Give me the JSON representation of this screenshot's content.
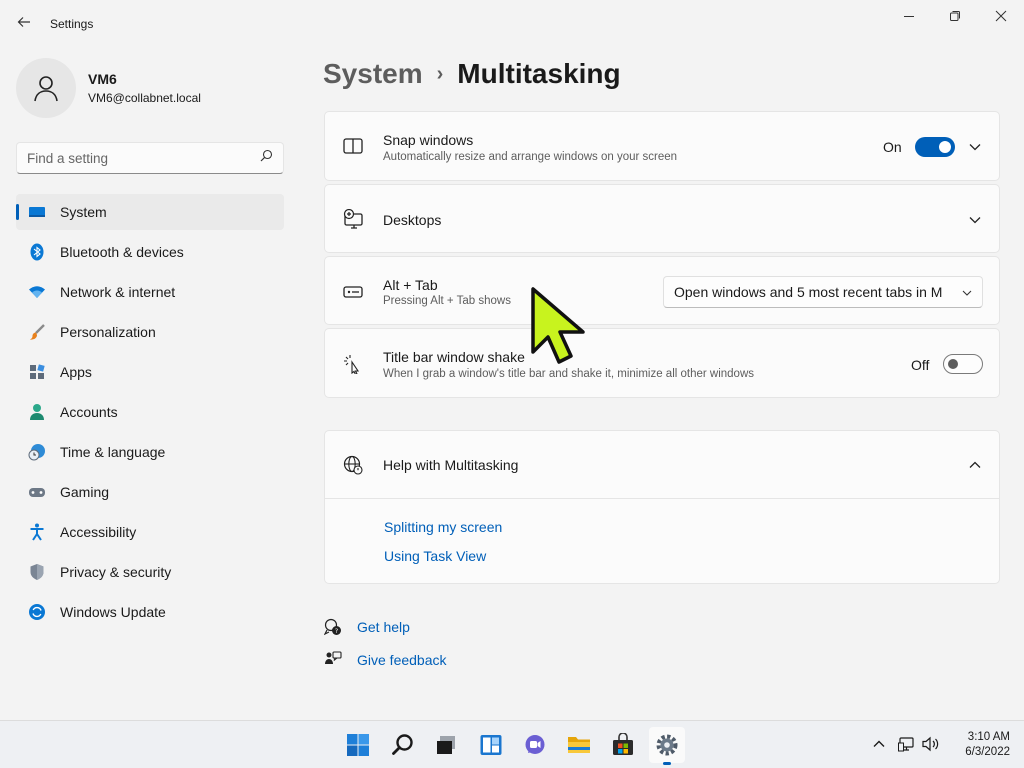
{
  "window": {
    "title": "Settings"
  },
  "profile": {
    "name": "VM6",
    "email": "VM6@collabnet.local"
  },
  "search": {
    "placeholder": "Find a setting"
  },
  "nav": [
    {
      "label": "System",
      "icon": "system-icon",
      "active": true
    },
    {
      "label": "Bluetooth & devices",
      "icon": "bluetooth-icon"
    },
    {
      "label": "Network & internet",
      "icon": "network-icon"
    },
    {
      "label": "Personalization",
      "icon": "brush-icon"
    },
    {
      "label": "Apps",
      "icon": "apps-icon"
    },
    {
      "label": "Accounts",
      "icon": "accounts-icon"
    },
    {
      "label": "Time & language",
      "icon": "clock-globe-icon"
    },
    {
      "label": "Gaming",
      "icon": "gamepad-icon"
    },
    {
      "label": "Accessibility",
      "icon": "accessibility-icon"
    },
    {
      "label": "Privacy & security",
      "icon": "shield-icon"
    },
    {
      "label": "Windows Update",
      "icon": "update-icon"
    }
  ],
  "breadcrumb": {
    "parent": "System",
    "separator": "›",
    "current": "Multitasking"
  },
  "settings": {
    "snap": {
      "title": "Snap windows",
      "desc": "Automatically resize and arrange windows on your screen",
      "state_label": "On",
      "enabled": true
    },
    "desktops": {
      "title": "Desktops"
    },
    "alttab": {
      "title": "Alt + Tab",
      "desc": "Pressing Alt + Tab shows",
      "value": "Open windows and 5 most recent tabs in M"
    },
    "shake": {
      "title": "Title bar window shake",
      "desc": "When I grab a window's title bar and shake it, minimize all other windows",
      "state_label": "Off",
      "enabled": false
    }
  },
  "help": {
    "title": "Help with Multitasking",
    "links": [
      "Splitting my screen",
      "Using Task View"
    ]
  },
  "footer_links": {
    "get_help": "Get help",
    "give_feedback": "Give feedback"
  },
  "taskbar": {
    "apps": [
      "start-icon",
      "search-icon",
      "task-view-icon",
      "widgets-icon",
      "chat-icon",
      "file-explorer-icon",
      "store-icon",
      "settings-icon"
    ],
    "clock": {
      "time": "3:10 AM",
      "date": "6/3/2022"
    }
  },
  "colors": {
    "accent": "#005fb8",
    "cursor": "#c8f31e"
  }
}
